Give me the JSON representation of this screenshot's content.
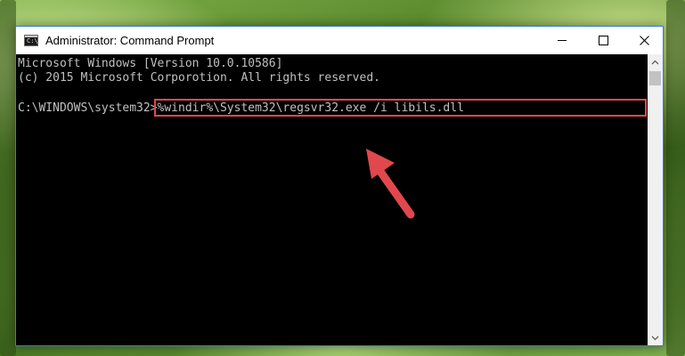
{
  "window": {
    "title": "Administrator: Command Prompt",
    "app_icon_text": "C:\\",
    "controls": {
      "minimize": "minimize-icon",
      "maximize": "maximize-icon",
      "close": "close-icon"
    }
  },
  "console": {
    "lines": [
      "Microsoft Windows [Version 10.0.10586]",
      "(c) 2015 Microsoft Corporotion. All rights reserved.",
      "",
      "C:\\WINDOWS\\system32>%windir%\\System32\\regsvr32.exe /i libils.dll"
    ]
  },
  "annotations": {
    "highlight_color": "#e0484e",
    "arrow_color": "#e0484e",
    "arrow_icon": "red-arrow-icon"
  },
  "scrollbar": {
    "up_icon": "scroll-up-arrow-icon",
    "down_icon": "scroll-down-arrow-icon"
  }
}
